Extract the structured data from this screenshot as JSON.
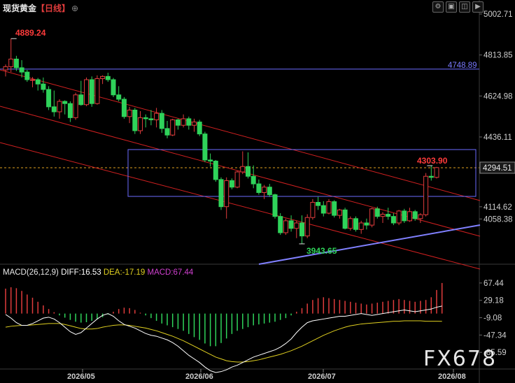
{
  "header": {
    "name": "现货黄金",
    "period": "【日线】",
    "settings_icon": "gear-icon"
  },
  "window_buttons": [
    "settings-icon",
    "image-icon",
    "restore-icon",
    "play-icon"
  ],
  "colors": {
    "up": "#e03c3c",
    "down": "#2fd35a",
    "background": "#000000",
    "hline": "#6b6bff",
    "dashed_price": "#e0a020",
    "diff": "#ffffff",
    "dea": "#e0d020",
    "macd": "#d040d0"
  },
  "chart_data": [
    {
      "type": "candlestick",
      "title": "现货黄金【日线】",
      "x_tick_labels": [
        "2026/05",
        "2026/06",
        "2026/07",
        "2026/08"
      ],
      "y_tick_labels": [
        "5002.71",
        "4813.85",
        "4624.98",
        "4436.11",
        "4294.51",
        "4114.62",
        "4058.38"
      ],
      "ylim": [
        3850,
        5002.71
      ],
      "last_price": "4294.51",
      "annotations": {
        "high": "4889.24",
        "low": "3943.65",
        "recent_high": "4303.90",
        "hline": "4748.89"
      },
      "candles": [
        [
          4745,
          4770,
          4715,
          4760
        ],
        [
          4760,
          4889.24,
          4735,
          4795
        ],
        [
          4795,
          4810,
          4740,
          4755
        ],
        [
          4755,
          4790,
          4710,
          4735
        ],
        [
          4735,
          4745,
          4690,
          4700
        ],
        [
          4700,
          4712,
          4665,
          4700
        ],
        [
          4700,
          4708,
          4650,
          4680
        ],
        [
          4680,
          4710,
          4640,
          4655
        ],
        [
          4655,
          4670,
          4560,
          4575
        ],
        [
          4575,
          4650,
          4530,
          4552
        ],
        [
          4552,
          4610,
          4520,
          4600
        ],
        [
          4600,
          4605,
          4540,
          4590
        ],
        [
          4590,
          4600,
          4505,
          4525
        ],
        [
          4525,
          4640,
          4515,
          4630
        ],
        [
          4630,
          4695,
          4580,
          4585
        ],
        [
          4585,
          4710,
          4578,
          4700
        ],
        [
          4700,
          4715,
          4575,
          4590
        ],
        [
          4590,
          4720,
          4585,
          4705
        ],
        [
          4705,
          4720,
          4680,
          4715
        ],
        [
          4715,
          4732,
          4690,
          4700
        ],
        [
          4700,
          4708,
          4620,
          4630
        ],
        [
          4630,
          4670,
          4600,
          4610
        ],
        [
          4610,
          4620,
          4520,
          4530
        ],
        [
          4530,
          4575,
          4500,
          4560
        ],
        [
          4560,
          4570,
          4450,
          4465
        ],
        [
          4465,
          4555,
          4450,
          4525
        ],
        [
          4525,
          4540,
          4480,
          4520
        ],
        [
          4520,
          4560,
          4490,
          4515
        ],
        [
          4515,
          4570,
          4480,
          4545
        ],
        [
          4545,
          4560,
          4455,
          4475
        ],
        [
          4475,
          4510,
          4430,
          4445
        ],
        [
          4445,
          4520,
          4440,
          4515
        ],
        [
          4515,
          4520,
          4470,
          4490
        ],
        [
          4490,
          4540,
          4480,
          4520
        ],
        [
          4520,
          4530,
          4470,
          4490
        ],
        [
          4490,
          4520,
          4460,
          4505
        ],
        [
          4505,
          4515,
          4440,
          4450
        ],
        [
          4450,
          4460,
          4320,
          4330
        ],
        [
          4330,
          4360,
          4300,
          4325
        ],
        [
          4325,
          4330,
          4230,
          4240
        ],
        [
          4240,
          4250,
          4100,
          4115
        ],
        [
          4115,
          4250,
          4060,
          4235
        ],
        [
          4235,
          4245,
          4195,
          4205
        ],
        [
          4205,
          4280,
          4200,
          4275
        ],
        [
          4275,
          4370,
          4265,
          4300
        ],
        [
          4300,
          4365,
          4245,
          4255
        ],
        [
          4255,
          4305,
          4200,
          4220
        ],
        [
          4220,
          4240,
          4170,
          4180
        ],
        [
          4180,
          4215,
          4150,
          4205
        ],
        [
          4205,
          4220,
          4160,
          4170
        ],
        [
          4170,
          4175,
          4060,
          4070
        ],
        [
          4070,
          4085,
          3985,
          3995
        ],
        [
          3995,
          4060,
          3985,
          4050
        ],
        [
          4050,
          4075,
          4000,
          4015
        ],
        [
          4015,
          4050,
          3970,
          4040
        ],
        [
          4040,
          4075,
          3943.65,
          3980
        ],
        [
          3980,
          4080,
          3970,
          4065
        ],
        [
          4065,
          4150,
          4055,
          4135
        ],
        [
          4135,
          4160,
          4100,
          4120
        ],
        [
          4120,
          4140,
          4070,
          4085
        ],
        [
          4085,
          4150,
          4080,
          4138
        ],
        [
          4138,
          4145,
          4065,
          4075
        ],
        [
          4075,
          4105,
          4060,
          4100
        ],
        [
          4100,
          4110,
          4010,
          4015
        ],
        [
          4015,
          4070,
          4005,
          4060
        ],
        [
          4060,
          4070,
          4000,
          4010
        ],
        [
          4010,
          4050,
          3990,
          4040
        ],
        [
          4040,
          4060,
          4010,
          4030
        ],
        [
          4030,
          4110,
          4020,
          4105
        ],
        [
          4105,
          4115,
          4060,
          4070
        ],
        [
          4070,
          4090,
          4040,
          4080
        ],
        [
          4080,
          4110,
          4055,
          4070
        ],
        [
          4070,
          4085,
          4030,
          4040
        ],
        [
          4040,
          4100,
          4030,
          4095
        ],
        [
          4095,
          4105,
          4040,
          4050
        ],
        [
          4050,
          4110,
          4045,
          4092
        ],
        [
          4092,
          4100,
          4050,
          4060
        ],
        [
          4060,
          4085,
          4040,
          4078
        ],
        [
          4078,
          4270,
          4070,
          4255
        ],
        [
          4255,
          4303.9,
          4235,
          4250
        ],
        [
          4250,
          4298,
          4245,
          4295
        ]
      ]
    },
    {
      "type": "bar",
      "title": "MACD(26,12,9)",
      "legend": [
        {
          "label": "DIFF:16.53",
          "color": "#ffffff"
        },
        {
          "label": "DEA:-17.19",
          "color": "#e0d020"
        },
        {
          "label": "MACD:67.44",
          "color": "#d040d0"
        }
      ],
      "y_tick_labels": [
        "67.44",
        "29.18",
        "-9.08",
        "-47.34",
        "-85.59"
      ],
      "ylim": [
        -110,
        75
      ],
      "macd": [
        55,
        58,
        56,
        50,
        42,
        35,
        26,
        18,
        10,
        3,
        -4,
        -9,
        -14,
        -18,
        -20,
        -19,
        -16,
        -12,
        -8,
        -2,
        4,
        10,
        13,
        12,
        8,
        2,
        -4,
        -10,
        -16,
        -22,
        -26,
        -30,
        -34,
        -38,
        -45,
        -52,
        -58,
        -66,
        -72,
        -72,
        -65,
        -55,
        -45,
        -38,
        -34,
        -30,
        -26,
        -24,
        -22,
        -20,
        -18,
        -14,
        -10,
        -4,
        4,
        12,
        22,
        30,
        34,
        36,
        34,
        32,
        30,
        28,
        26,
        24,
        22,
        20,
        22,
        24,
        26,
        28,
        30,
        32,
        30,
        28,
        26,
        28,
        30,
        36,
        52,
        67.44
      ],
      "diff": [
        -2,
        -10,
        -20,
        -26,
        -26,
        -22,
        -16,
        -10,
        -8,
        -12,
        -20,
        -30,
        -40,
        -46,
        -42,
        -32,
        -22,
        -12,
        -4,
        0,
        -6,
        -16,
        -24,
        -28,
        -32,
        -38,
        -44,
        -48,
        -50,
        -54,
        -58,
        -64,
        -72,
        -82,
        -92,
        -100,
        -108,
        -118,
        -126,
        -130,
        -128,
        -124,
        -118,
        -114,
        -108,
        -102,
        -96,
        -92,
        -88,
        -84,
        -80,
        -74,
        -66,
        -56,
        -42,
        -30,
        -20,
        -16,
        -14,
        -12,
        -10,
        -8,
        -6,
        -6,
        -4,
        -2,
        0,
        -2,
        -4,
        -2,
        0,
        2,
        4,
        6,
        8,
        6,
        4,
        6,
        8,
        10,
        14,
        16.53
      ],
      "dea": [
        -30,
        -28,
        -27,
        -26,
        -26,
        -25,
        -24,
        -23,
        -22,
        -22,
        -22,
        -24,
        -27,
        -30,
        -33,
        -34,
        -34,
        -33,
        -30,
        -28,
        -26,
        -25,
        -25,
        -26,
        -28,
        -30,
        -32,
        -35,
        -38,
        -42,
        -46,
        -50,
        -55,
        -60,
        -66,
        -72,
        -78,
        -84,
        -90,
        -96,
        -100,
        -104,
        -106,
        -107,
        -107,
        -106,
        -104,
        -102,
        -99,
        -96,
        -93,
        -90,
        -86,
        -82,
        -77,
        -72,
        -66,
        -60,
        -54,
        -48,
        -43,
        -38,
        -34,
        -30,
        -27,
        -25,
        -23,
        -22,
        -21,
        -20,
        -19,
        -18,
        -17,
        -17,
        -16,
        -16,
        -16,
        -16,
        -17,
        -17,
        -17,
        -17.19
      ]
    }
  ],
  "watermark": "FX678"
}
